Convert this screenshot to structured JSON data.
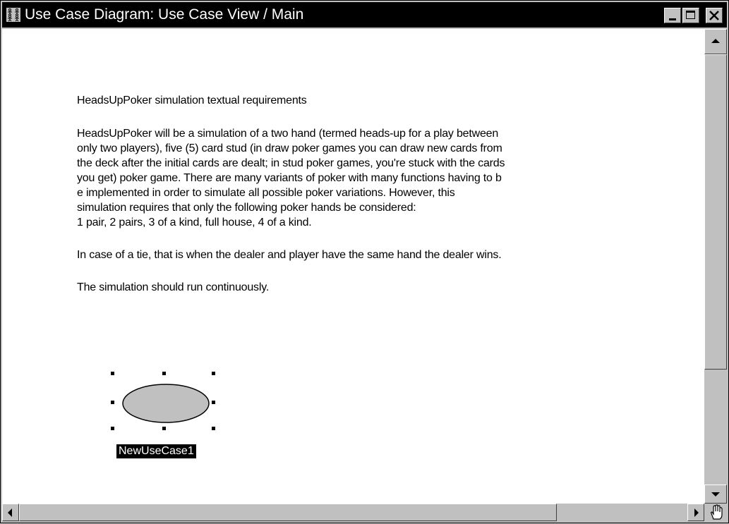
{
  "window": {
    "title": "Use Case Diagram: Use Case View / Main",
    "icon": "actors-icon",
    "controls": [
      "minimize-icon",
      "maximize-icon",
      "close-icon"
    ]
  },
  "requirements": {
    "heading": "HeadsUpPoker simulation textual requirements",
    "paragraph1_lines": [
      "HeadsUpPoker will be a simulation of a two hand (termed heads-up for a play between",
      "only two players), five (5) card stud (in draw poker games you can draw new cards from",
      "the deck after the initial cards are dealt; in stud poker games, you're stuck with the cards",
      "you get) poker game. There are many variants of poker with many functions having to b",
      "e implemented in order to simulate all possible poker variations. However, this",
      "simulation requires that only the following poker hands be considered:",
      "1 pair, 2 pairs, 3 of a kind, full house, 4 of a kind."
    ],
    "paragraph2": "In case of a tie, that is when the dealer and player have the same hand the dealer wins.",
    "paragraph3": "The simulation should run continuously."
  },
  "diagram": {
    "use_case_label": "NewUseCase1",
    "use_case_fill": "#c0c0c0"
  },
  "scrollbars": {
    "corner_icon": "hand-cursor-icon"
  }
}
